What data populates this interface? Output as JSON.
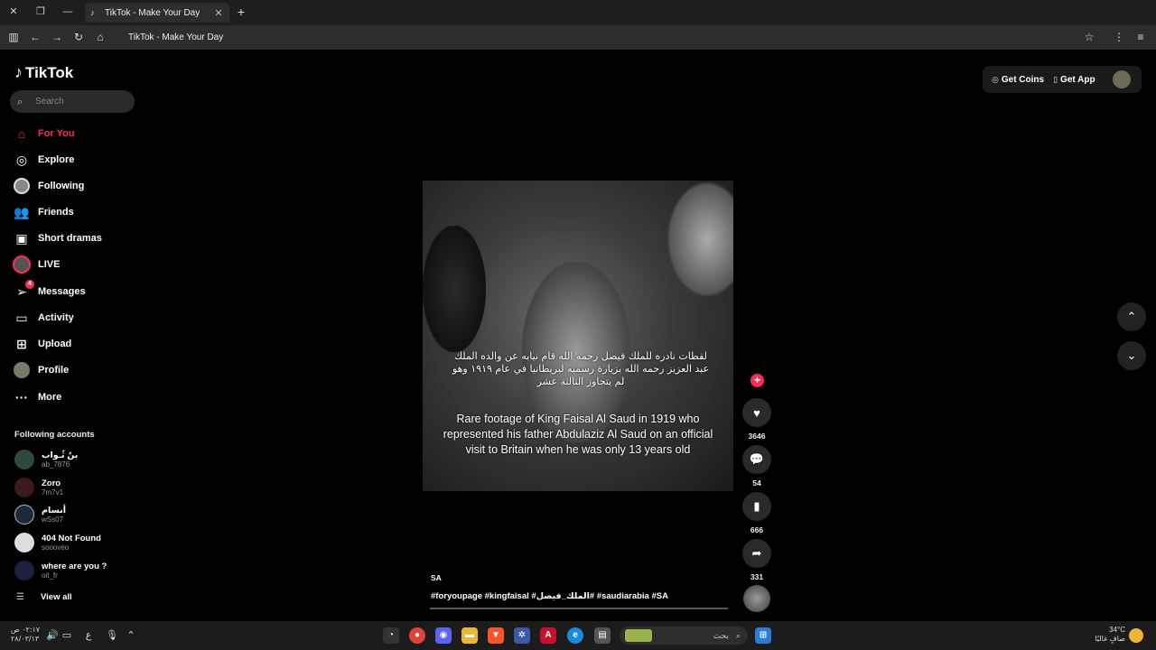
{
  "browser": {
    "tab_title": "TikTok - Make Your Day",
    "address": "TikTok - Make Your Day",
    "tab_icon": "tiktok-icon"
  },
  "tiktok": {
    "logo_text": "TikTok",
    "search_placeholder": "Search",
    "nav": [
      {
        "label": "For You",
        "icon": "home-icon"
      },
      {
        "label": "Explore",
        "icon": "compass-icon"
      },
      {
        "label": "Following",
        "icon": "avatar-icon"
      },
      {
        "label": "Friends",
        "icon": "friends-icon"
      },
      {
        "label": "Short dramas",
        "icon": "film-icon"
      },
      {
        "label": "LIVE",
        "icon": "live-icon"
      },
      {
        "label": "Messages",
        "icon": "send-icon",
        "badge": "4"
      },
      {
        "label": "Activity",
        "icon": "message-box-icon"
      },
      {
        "label": "Upload",
        "icon": "plus-box-icon"
      },
      {
        "label": "Profile",
        "icon": "profile-icon"
      },
      {
        "label": "More",
        "icon": "more-icon"
      }
    ],
    "following_title": "Following accounts",
    "accounts": [
      {
        "name": "بنٌ ثُـواب",
        "handle": "ab_7876",
        "color": "#2e4a3a"
      },
      {
        "name": "Zoro",
        "handle": "7m7v1",
        "color": "#3a1a1a"
      },
      {
        "name": "أنسام",
        "handle": "wSs07",
        "color": "#1a2a3a"
      },
      {
        "name": "404 Not Found",
        "handle": "sooovéo",
        "color": "#dddddd"
      },
      {
        "name": "where are you ?",
        "handle": "oit_fr",
        "color": "#1a2240"
      }
    ],
    "view_all": "View all",
    "top_right": {
      "coins": "Get Coins",
      "app": "Get App"
    }
  },
  "video": {
    "caption_ar": "لقطات نادره للملك فيصل رحمه الله قام نيابه عن والده الملك عبد العزيز رحمه الله بزيارة رسميه لبريطانيا في عام ١٩١٩ وهو لم يتجاوز الثالثة عشر",
    "caption_en": "Rare footage of King Faisal Al Saud in 1919 who represented his father Abdulaziz Al Saud on an official visit to Britain when he was only 13 years old",
    "username": "SA",
    "hashtags": "#foryoupage #kingfaisal #الملك_فيصل# #saudiarabia #SA",
    "likes": "3646",
    "comments": "54",
    "saves": "666",
    "shares": "331"
  },
  "taskbar": {
    "time": "٠٢:١٧ ص",
    "date": "٢٨/٠٣/١٣",
    "lang": "ع",
    "search_text": "بحث",
    "temp": "34°C",
    "weather": "صافٍ غالبًا"
  },
  "colors": {
    "accent": "#fe2c55",
    "background": "#000000"
  }
}
